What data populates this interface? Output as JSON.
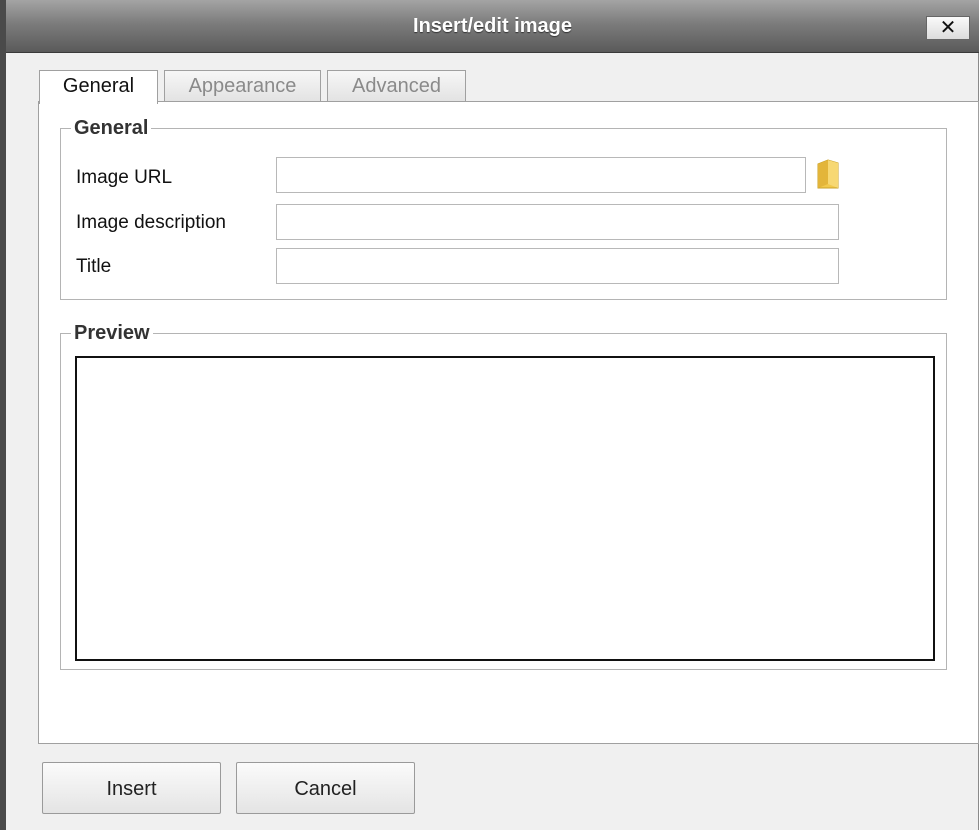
{
  "dialog": {
    "title": "Insert/edit image",
    "close_label": "✕"
  },
  "tabs": [
    {
      "label": "General",
      "active": true
    },
    {
      "label": "Appearance",
      "active": false
    },
    {
      "label": "Advanced",
      "active": false
    }
  ],
  "general": {
    "legend": "General",
    "fields": [
      {
        "label": "Image URL",
        "value": "",
        "placeholder": ""
      },
      {
        "label": "Image description",
        "value": "",
        "placeholder": ""
      },
      {
        "label": "Title",
        "value": "",
        "placeholder": ""
      }
    ],
    "browse_icon": "folder-icon"
  },
  "preview": {
    "legend": "Preview"
  },
  "footer": {
    "insert_label": "Insert",
    "cancel_label": "Cancel"
  },
  "colors": {
    "titlebar": "#7c7c7c",
    "folder": "#f2c94c"
  }
}
